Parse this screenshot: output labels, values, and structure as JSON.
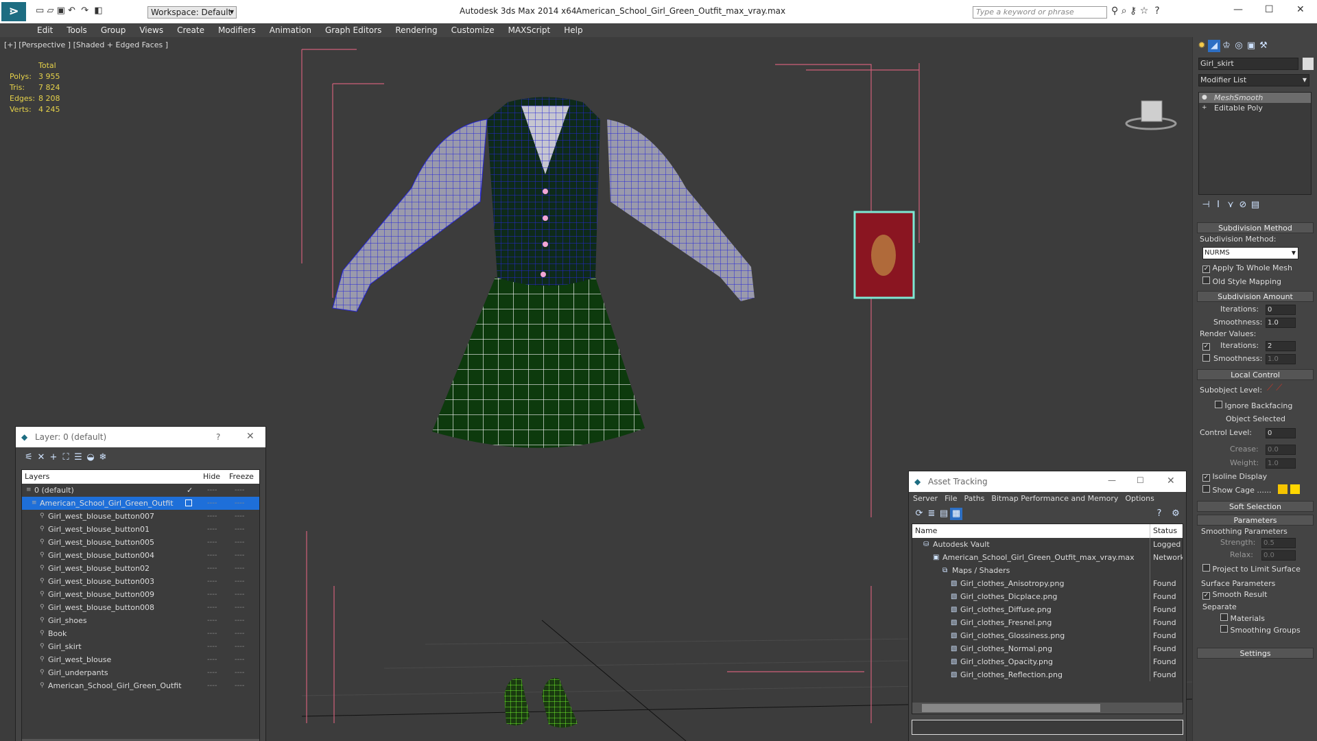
{
  "titlebar": {
    "app_title": "Autodesk 3ds Max  2014 x64",
    "file_title": "American_School_Girl_Green_Outfit_max_vray.max",
    "workspace": "Workspace: Default",
    "search_placeholder": "Type a keyword or phrase",
    "controls": [
      "—",
      "☐",
      "✕"
    ]
  },
  "menu": [
    "Edit",
    "Tools",
    "Group",
    "Views",
    "Create",
    "Modifiers",
    "Animation",
    "Graph Editors",
    "Rendering",
    "Customize",
    "MAXScript",
    "Help"
  ],
  "viewport": {
    "label": "[+] [Perspective ] [Shaded + Edged Faces ]",
    "stats": {
      "header": "Total",
      "polys_label": "Polys:",
      "polys": "3 955",
      "tris_label": "Tris:",
      "tris": "7 824",
      "edges_label": "Edges:",
      "edges": "8 208",
      "verts_label": "Verts:",
      "verts": "4 245"
    }
  },
  "layer_window": {
    "title": "Layer: 0 (default)",
    "col_layers": "Layers",
    "col_hide": "Hide",
    "col_freeze": "Freeze",
    "items": [
      "0 (default)",
      "American_School_Girl_Green_Outfit",
      "Girl_west_blouse_button007",
      "Girl_west_blouse_button01",
      "Girl_west_blouse_button005",
      "Girl_west_blouse_button004",
      "Girl_west_blouse_button02",
      "Girl_west_blouse_button003",
      "Girl_west_blouse_button009",
      "Girl_west_blouse_button008",
      "Girl_shoes",
      "Book",
      "Girl_skirt",
      "Girl_west_blouse",
      "Girl_underpants",
      "American_School_Girl_Green_Outfit"
    ],
    "dash": "----"
  },
  "asset_window": {
    "title": "Asset Tracking",
    "menu": [
      "Server",
      "File",
      "Paths",
      "Bitmap Performance and Memory",
      "Options"
    ],
    "col_name": "Name",
    "col_status": "Status",
    "rows": [
      {
        "name": "Autodesk Vault",
        "status": "Logged Ou"
      },
      {
        "name": "American_School_Girl_Green_Outfit_max_vray.max",
        "status": "Network P"
      },
      {
        "name": "Maps / Shaders",
        "status": ""
      },
      {
        "name": "Girl_clothes_Anisotropy.png",
        "status": "Found"
      },
      {
        "name": "Girl_clothes_Dicplace.png",
        "status": "Found"
      },
      {
        "name": "Girl_clothes_Diffuse.png",
        "status": "Found"
      },
      {
        "name": "Girl_clothes_Fresnel.png",
        "status": "Found"
      },
      {
        "name": "Girl_clothes_Glossiness.png",
        "status": "Found"
      },
      {
        "name": "Girl_clothes_Normal.png",
        "status": "Found"
      },
      {
        "name": "Girl_clothes_Opacity.png",
        "status": "Found"
      },
      {
        "name": "Girl_clothes_Reflection.png",
        "status": "Found"
      }
    ]
  },
  "command_panel": {
    "object_name": "Girl_skirt",
    "modifier_list": "Modifier List",
    "stack": [
      "MeshSmooth",
      "Editable Poly"
    ],
    "subdiv_method_hdr": "Subdivision Method",
    "subdiv_method_lbl": "Subdivision Method:",
    "subdiv_method_val": "NURMS",
    "apply_whole": "Apply To Whole Mesh",
    "old_style": "Old Style Mapping",
    "subdiv_amount_hdr": "Subdivision Amount",
    "iterations_lbl": "Iterations:",
    "iterations": "0",
    "smoothness_lbl": "Smoothness:",
    "smoothness": "1.0",
    "render_values": "Render Values:",
    "r_iterations": "2",
    "r_smoothness": "1.0",
    "local_control_hdr": "Local Control",
    "subobject_lbl": "Subobject Level:",
    "ignore_backfacing": "Ignore Backfacing",
    "object_selected": "Object Selected",
    "control_level_lbl": "Control Level:",
    "control_level": "0",
    "crease_lbl": "Crease:",
    "crease": "0.0",
    "weight_lbl": "Weight:",
    "weight": "1.0",
    "isoline": "Isoline Display",
    "show_cage": "Show Cage ......",
    "soft_sel_hdr": "Soft Selection",
    "params_hdr": "Parameters",
    "smoothing_params": "Smoothing Parameters",
    "strength_lbl": "Strength:",
    "strength": "0.5",
    "relax_lbl": "Relax:",
    "relax": "0.0",
    "project_limit": "Project to Limit Surface",
    "surface_params": "Surface Parameters",
    "smooth_result": "Smooth Result",
    "separate": "Separate",
    "materials": "Materials",
    "smoothing_groups": "Smoothing Groups",
    "settings_hdr": "Settings"
  },
  "colors": {
    "wire": "#1e1ed0",
    "cage_a": "#f5c400",
    "cage_b": "#ffd700",
    "selection": "#1e6fd9"
  }
}
